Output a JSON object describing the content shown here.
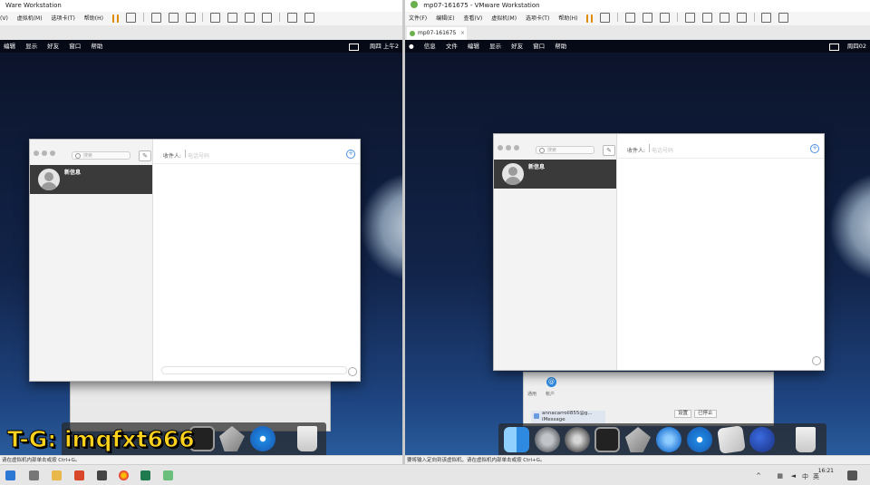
{
  "left": {
    "vm_title": "Ware Workstation",
    "vm_menu": [
      "(V)",
      "虚拟机(M)",
      "选项卡(T)",
      "帮助(H)"
    ],
    "mac_menu": [
      "编辑",
      "显示",
      "好友",
      "窗口",
      "帮助"
    ],
    "mac_clock": "周四 上午2",
    "search_placeholder": "搜索",
    "conversation_name": "新信息",
    "recipient_label": "收件人:",
    "recipient_placeholder": "电话号码",
    "status_text": "请在虚拟机内部单击或按 Ctrl+G。"
  },
  "right": {
    "vm_title": "mp07-161675 - VMware Workstation",
    "vm_menu": [
      "文件(F)",
      "编辑(E)",
      "查看(V)",
      "虚拟机(M)",
      "选项卡(T)",
      "帮助(H)"
    ],
    "tab_label": "mp07-161675",
    "mac_menu": [
      "信息",
      "文件",
      "编辑",
      "显示",
      "好友",
      "窗口",
      "帮助"
    ],
    "mac_clock": "周四02",
    "search_placeholder": "搜索",
    "conversation_name": "新信息",
    "recipient_label": "收件人:",
    "recipient_placeholder": "电话号码",
    "behind_labels": [
      "通用",
      "帐户"
    ],
    "account_email": "annacarroll855@g...",
    "account_type": "iMessage",
    "behind_buttons": [
      "设置",
      "已停止"
    ],
    "status_text": "要将输入定向到该虚拟机，请在虚拟机内部单击或按 Ctrl+G。"
  },
  "watermark": "T-G: imqfxt666",
  "taskbar": {
    "time": "16:21",
    "tray": [
      "^",
      "中",
      "英"
    ]
  },
  "colors": {
    "watermark": "#ffd21e",
    "selected_conversation": "#3a3a3a",
    "accent": "#4a90e2"
  }
}
